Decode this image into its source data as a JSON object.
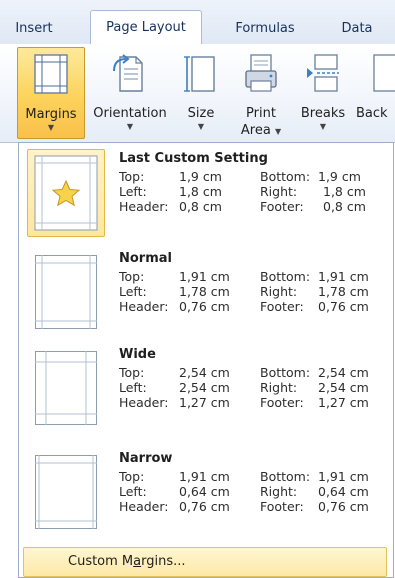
{
  "tabs": [
    {
      "label": "Insert",
      "active": false
    },
    {
      "label": "Page Layout",
      "active": true
    },
    {
      "label": "Formulas",
      "active": false
    },
    {
      "label": "Data",
      "active": false
    }
  ],
  "ribbon": {
    "margins": {
      "label": "Margins",
      "icon": "margins-icon"
    },
    "orientation": {
      "label": "Orientation",
      "icon": "orientation-icon"
    },
    "size": {
      "label": "Size",
      "icon": "size-icon"
    },
    "print_area": {
      "label_line1": "Print",
      "label_line2": "Area",
      "icon": "print-area-icon"
    },
    "breaks": {
      "label": "Breaks",
      "icon": "breaks-icon"
    },
    "background": {
      "label": "Back",
      "icon": "background-icon"
    }
  },
  "menu": {
    "presets": [
      {
        "title": "Last Custom Setting",
        "top_label": "Top:",
        "top": "1,9 cm",
        "bottom_label": "Bottom:",
        "bottom": "1,9 cm",
        "left_label": "Left:",
        "left": "1,8 cm",
        "right_label": "Right:",
        "right": "1,8 cm",
        "header_label": "Header:",
        "header": "0,8 cm",
        "footer_label": "Footer:",
        "footer": "0,8 cm",
        "icon": "star-page-icon"
      },
      {
        "title": "Normal",
        "top_label": "Top:",
        "top": "1,91 cm",
        "bottom_label": "Bottom:",
        "bottom": "1,91 cm",
        "left_label": "Left:",
        "left": "1,78 cm",
        "right_label": "Right:",
        "right": "1,78 cm",
        "header_label": "Header:",
        "header": "0,76 cm",
        "footer_label": "Footer:",
        "footer": "0,76 cm",
        "icon": "page-margins-icon"
      },
      {
        "title": "Wide",
        "top_label": "Top:",
        "top": "2,54 cm",
        "bottom_label": "Bottom:",
        "bottom": "2,54 cm",
        "left_label": "Left:",
        "left": "2,54 cm",
        "right_label": "Right:",
        "right": "2,54 cm",
        "header_label": "Header:",
        "header": "1,27 cm",
        "footer_label": "Footer:",
        "footer": "1,27 cm",
        "icon": "page-margins-icon"
      },
      {
        "title": "Narrow",
        "top_label": "Top:",
        "top": "1,91 cm",
        "bottom_label": "Bottom:",
        "bottom": "1,91 cm",
        "left_label": "Left:",
        "left": "0,64 cm",
        "right_label": "Right:",
        "right": "0,64 cm",
        "header_label": "Header:",
        "header": "0,76 cm",
        "footer_label": "Footer:",
        "footer": "0,76 cm",
        "icon": "page-margins-icon"
      }
    ],
    "custom_margins_pre": "Custom M",
    "custom_margins_underlined": "a",
    "custom_margins_post": "rgins..."
  }
}
